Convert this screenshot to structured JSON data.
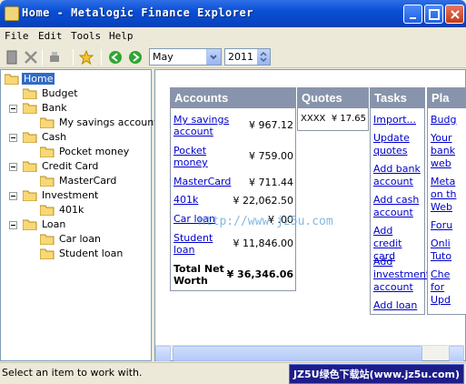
{
  "window": {
    "title": "Home - Metalogic Finance Explorer"
  },
  "menu": {
    "file": "File",
    "edit": "Edit",
    "tools": "Tools",
    "help": "Help"
  },
  "toolbar": {
    "month": "May",
    "year": "2011"
  },
  "tree": {
    "home": "Home",
    "budget": "Budget",
    "bank": "Bank",
    "my_savings": "My savings account",
    "cash": "Cash",
    "pocket_money": "Pocket money",
    "credit_card": "Credit Card",
    "mastercard": "MasterCard",
    "investment": "Investment",
    "k401": "401k",
    "loan": "Loan",
    "car_loan": "Car loan",
    "student_loan": "Student loan"
  },
  "panels": {
    "accounts": {
      "title": "Accounts",
      "rows": [
        {
          "name_line1": "My savings",
          "name_line2": "account",
          "amount": "¥ 967.12"
        },
        {
          "name_line1": "Pocket",
          "name_line2": "money",
          "amount": "¥ 759.00"
        },
        {
          "name_line1": "MasterCard",
          "name_line2": "",
          "amount": "¥ 711.44"
        },
        {
          "name_line1": "401k",
          "name_line2": "",
          "amount": "¥ 22,062.50"
        },
        {
          "name_line1": "Car loan",
          "name_line2": "",
          "amount": "¥ .00"
        },
        {
          "name_line1": "Student",
          "name_line2": "loan",
          "amount": "¥ 11,846.00"
        }
      ],
      "total_label_line1": "Total Net",
      "total_label_line2": "Worth",
      "total_amount": "¥ 36,346.06"
    },
    "quotes": {
      "title": "Quotes",
      "symbol": "XXXX",
      "price": "¥ 17.65"
    },
    "tasks": {
      "title": "Tasks",
      "items": [
        "Import...",
        "Update quotes",
        "Add bank account",
        "Add cash account",
        "Add credit card",
        "Add investment account",
        "Add loan"
      ]
    },
    "plan": {
      "title": "Pla",
      "items": [
        "Budg",
        "Your",
        "bank",
        "web",
        "Meta",
        "on th",
        "Web",
        "Foru",
        "Onli",
        "Tuto",
        "Che",
        "for",
        "Upd"
      ]
    }
  },
  "watermark": "http://www.jz5u.com",
  "status": {
    "text": "Select an item to work with.",
    "badge": "JZ5U绿色下载站(www.jz5u.com)"
  }
}
